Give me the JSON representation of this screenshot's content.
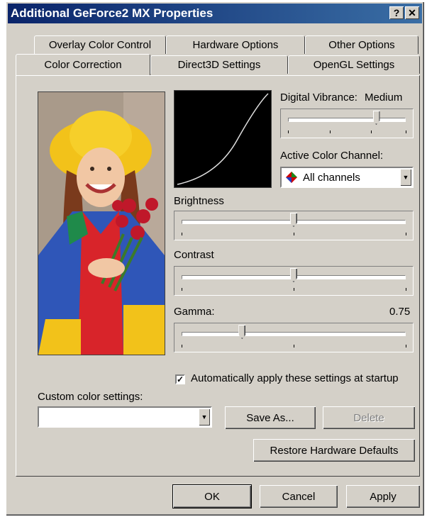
{
  "window": {
    "title": "Additional GeForce2 MX Properties"
  },
  "titlebar_buttons": {
    "help": "?",
    "close": "✕"
  },
  "tabs_row1": [
    "Overlay Color Control",
    "Hardware Options",
    "Other Options"
  ],
  "tabs_row2": [
    "Color Correction",
    "Direct3D Settings",
    "OpenGL Settings"
  ],
  "active_tab": "Color Correction",
  "digital_vibrance": {
    "label": "Digital Vibrance:",
    "value": "Medium",
    "level": 0.75
  },
  "active_color_channel": {
    "label": "Active Color Channel:",
    "value": "All channels"
  },
  "brightness": {
    "label": "Brightness",
    "level": 0.5
  },
  "contrast": {
    "label": "Contrast",
    "level": 0.5
  },
  "gamma": {
    "label": "Gamma:",
    "value": "0.75",
    "level": 0.27
  },
  "auto_apply": {
    "label": "Automatically apply these settings at startup",
    "checked": true
  },
  "custom_color": {
    "label": "Custom color settings:",
    "value": ""
  },
  "buttons": {
    "save_as": "Save As...",
    "delete": "Delete",
    "restore": "Restore Hardware Defaults",
    "ok": "OK",
    "cancel": "Cancel",
    "apply": "Apply"
  },
  "colors": {
    "titlebar": "#0a246a",
    "face": "#d4d0c8"
  }
}
